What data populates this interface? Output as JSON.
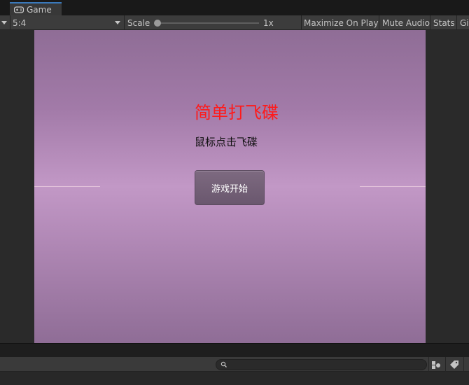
{
  "tab": {
    "label": "Game",
    "icon": "gamepad-icon"
  },
  "toolbar": {
    "aspect_value": "5:4",
    "scale_label": "Scale",
    "scale_value": "1x",
    "maximize_label": "Maximize On Play",
    "mute_label": "Mute Audio",
    "stats_label": "Stats",
    "gizmos_label": "Gi"
  },
  "game": {
    "title": "简单打飞碟",
    "subtitle": "鼠标点击飞碟",
    "start_button": "游戏开始",
    "title_color": "#ff1a1a"
  },
  "bottom_bar": {
    "search_placeholder": ""
  }
}
